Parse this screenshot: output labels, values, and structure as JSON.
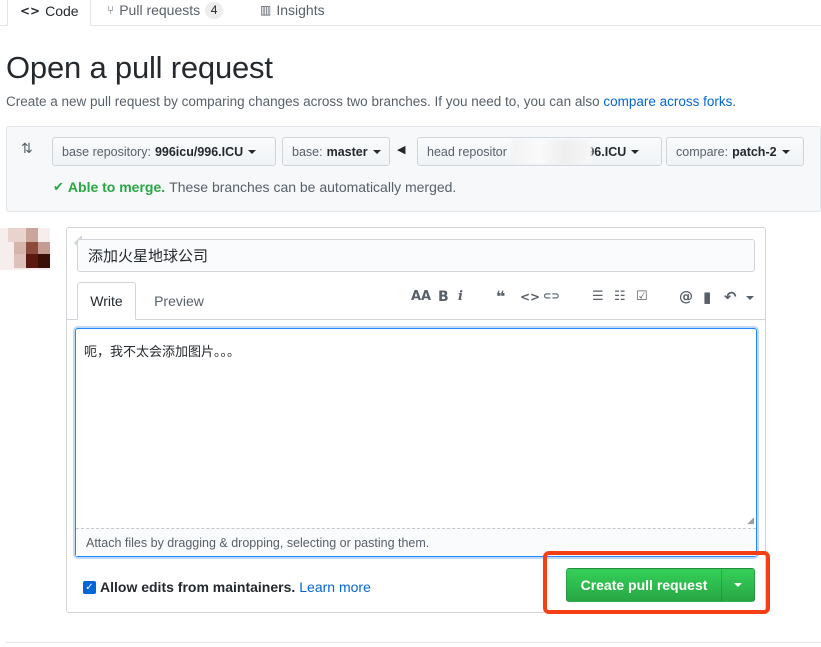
{
  "tabs": [
    {
      "icon": "code-icon",
      "glyph": "<>",
      "label": "Code",
      "selected": true
    },
    {
      "icon": "pull-request-icon",
      "glyph": "⑂",
      "label": "Pull requests",
      "count": "4"
    },
    {
      "icon": "graph-icon",
      "glyph": "▥",
      "label": "Insights"
    }
  ],
  "page": {
    "title": "Open a pull request",
    "subtitle": "Create a new pull request by comparing changes across two branches. If you need to, you can also ",
    "subtitle_link": "compare across forks",
    "subtitle_end": "."
  },
  "range": {
    "base_repo_label": "base repository:",
    "base_repo_value": "996icu/996.ICU",
    "base_label": "base:",
    "base_value": "master",
    "head_repo_label": "head repositor",
    "head_repo_value": "/996.ICU",
    "compare_label": "compare:",
    "compare_value": "patch-2",
    "merge_ok": "Able to merge.",
    "merge_text": "These branches can be automatically merged."
  },
  "form": {
    "title_value": "添加火星地球公司",
    "write_tab": "Write",
    "preview_tab": "Preview",
    "toolbar": {
      "header": "AA",
      "bold": "B",
      "italic": "i",
      "quote": "❝",
      "code": "<>",
      "link": "⊂⊃",
      "ul": "☰",
      "ol": "☷",
      "task": "☑",
      "mention": "@",
      "saved": "▮",
      "reply": "↶"
    },
    "body_value": "呃，我不太会添加图片。。。",
    "attach_text": "Attach files by dragging & dropping, selecting or pasting them.",
    "allow_edits_label": "Allow edits from maintainers.",
    "learn_more": "Learn more",
    "allow_edits_checked": true,
    "create_button": "Create pull request"
  },
  "colors": {
    "accent": "#0366d6",
    "success": "#28a745",
    "highlight": "#f43f16"
  }
}
